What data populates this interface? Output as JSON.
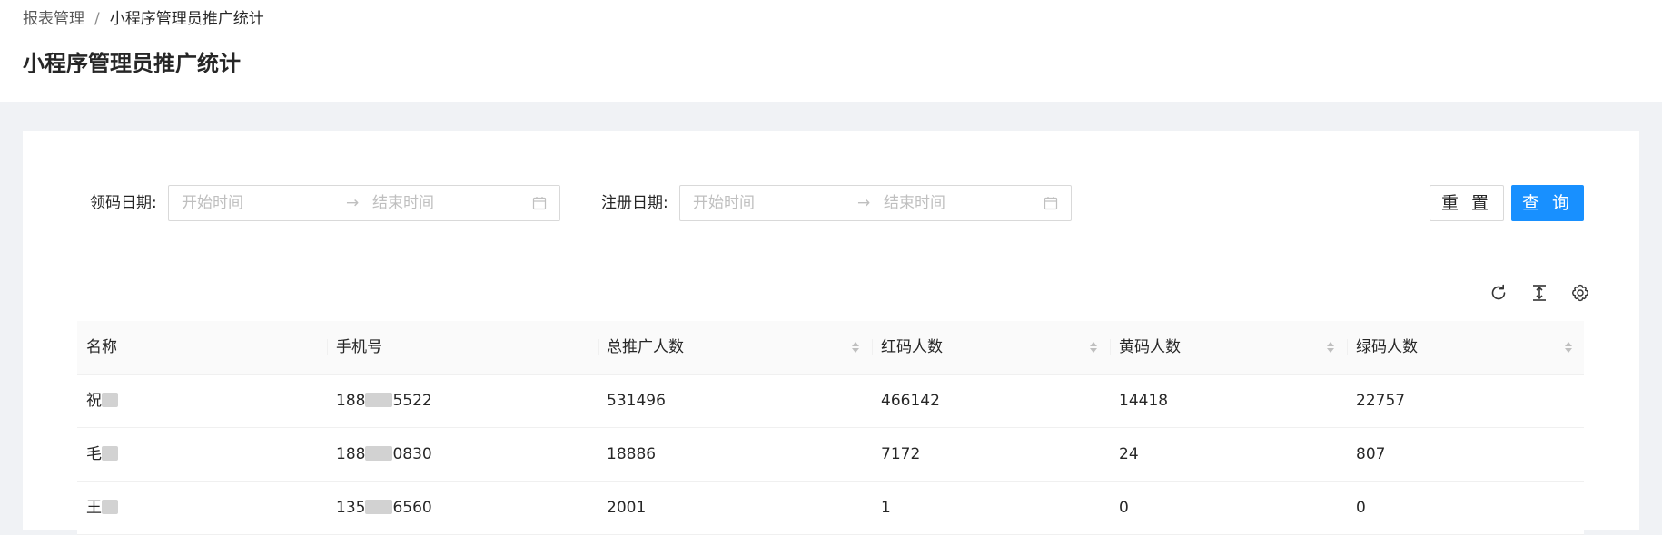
{
  "breadcrumb": {
    "parent": "报表管理",
    "separator": "/",
    "current": "小程序管理员推广统计"
  },
  "page_title": "小程序管理员推广统计",
  "filters": {
    "code_date": {
      "label": "领码日期:",
      "start_placeholder": "开始时间",
      "end_placeholder": "结束时间"
    },
    "register_date": {
      "label": "注册日期:",
      "start_placeholder": "开始时间",
      "end_placeholder": "结束时间"
    },
    "reset_label": "重 置",
    "query_label": "查 询"
  },
  "toolbar": {
    "icons": [
      "reload-icon",
      "column-height-icon",
      "setting-icon"
    ]
  },
  "table": {
    "columns": [
      "名称",
      "手机号",
      "总推广人数",
      "红码人数",
      "黄码人数",
      "绿码人数"
    ],
    "rows": [
      {
        "name_visible": "祝",
        "phone_prefix": "188",
        "phone_suffix": "5522",
        "total": "531496",
        "red": "466142",
        "yellow": "14418",
        "green": "22757"
      },
      {
        "name_visible": "毛",
        "phone_prefix": "188",
        "phone_suffix": "0830",
        "total": "18886",
        "red": "7172",
        "yellow": "24",
        "green": "807"
      },
      {
        "name_visible": "王",
        "phone_prefix": "135",
        "phone_suffix": "6560",
        "total": "2001",
        "red": "1",
        "yellow": "0",
        "green": "0"
      }
    ]
  },
  "colors": {
    "primary": "#1890ff",
    "background": "#f0f2f5",
    "border": "#d9d9d9",
    "placeholder": "#bfbfbf"
  }
}
